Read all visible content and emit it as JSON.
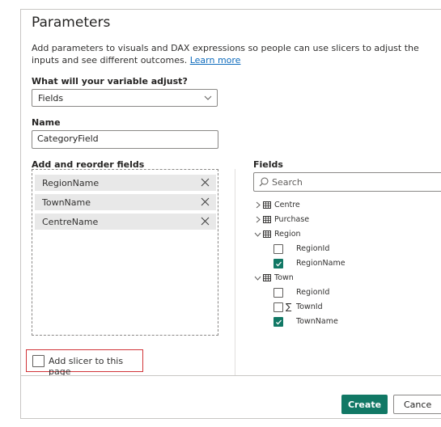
{
  "dialog": {
    "title": "Parameters",
    "description": "Add parameters to visuals and DAX expressions so people can use slicers to adjust the inputs and see different outcomes.",
    "learn_more": "Learn more"
  },
  "adjust": {
    "label": "What will your variable adjust?",
    "selected": "Fields"
  },
  "name": {
    "label": "Name",
    "value": "CategoryField"
  },
  "reorder": {
    "label": "Add and reorder fields",
    "items": [
      "RegionName",
      "TownName",
      "CentreName"
    ]
  },
  "slicer": {
    "label": "Add slicer to this page",
    "checked": false
  },
  "fields_pane": {
    "label": "Fields",
    "search_placeholder": "Search",
    "tables": [
      {
        "name": "Centre",
        "expanded": false,
        "columns": []
      },
      {
        "name": "Purchase",
        "expanded": false,
        "columns": []
      },
      {
        "name": "Region",
        "expanded": true,
        "columns": [
          {
            "name": "RegionId",
            "checked": false,
            "sigma": false
          },
          {
            "name": "RegionName",
            "checked": true,
            "sigma": false
          }
        ]
      },
      {
        "name": "Town",
        "expanded": true,
        "columns": [
          {
            "name": "RegionId",
            "checked": false,
            "sigma": false
          },
          {
            "name": "TownId",
            "checked": false,
            "sigma": true
          },
          {
            "name": "TownName",
            "checked": true,
            "sigma": false
          }
        ]
      }
    ]
  },
  "buttons": {
    "create": "Create",
    "cancel": "Cance"
  },
  "colors": {
    "accent": "#117865",
    "link": "#0f6cbd",
    "highlight_border": "#d13438"
  }
}
